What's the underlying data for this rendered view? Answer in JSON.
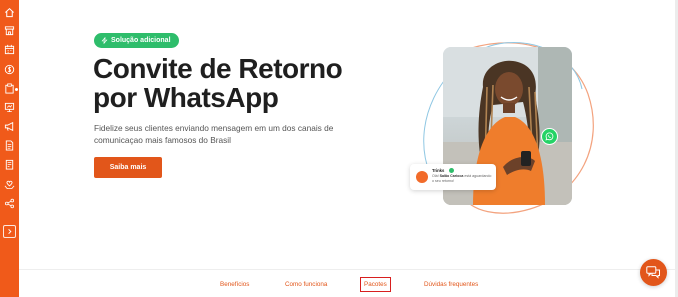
{
  "sidebar": {
    "icons": [
      "home-icon",
      "store-icon",
      "calendar-icon",
      "dollar-icon",
      "clipboard-icon",
      "presentation-icon",
      "megaphone-icon",
      "document-icon",
      "invoice-icon",
      "heart-hands-icon",
      "share-icon"
    ],
    "expand_icon": "chevron-right-icon"
  },
  "hero": {
    "badge_icon": "lightning-icon",
    "badge": "Solução adicional",
    "title": "Convite de Retorno por WhatsApp",
    "description": "Fidelize seus clientes enviando mensagem em um dos canais de comunicaçao mais famosos do Brasil",
    "cta": "Saiba mais"
  },
  "message_card": {
    "sender": "Trinks",
    "greeting": "Olá!",
    "salon": "Salão Carioca",
    "text_rest": "está aguardando o seu retorno!"
  },
  "bottom_nav": {
    "items": [
      "Benefícios",
      "Como funciona",
      "Pacotes",
      "Dúvidas frequentes"
    ],
    "active": "Pacotes"
  },
  "colors": {
    "brand": "#f05a1a",
    "cta": "#e2561a",
    "badge": "#2ebd6b",
    "whatsapp": "#25d366",
    "active_outline": "#d81f1f"
  },
  "chat_fab_icon": "chat-bubbles-icon"
}
